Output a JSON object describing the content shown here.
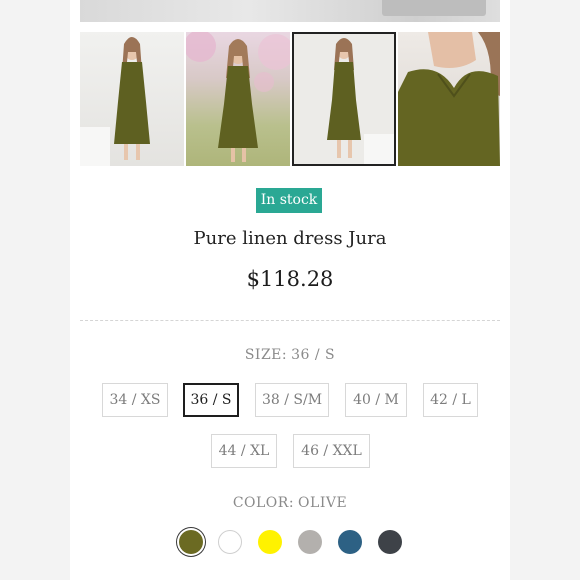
{
  "product": {
    "stock_badge": "In stock",
    "name": "Pure linen dress Jura",
    "price": "$118.28"
  },
  "gallery": {
    "thumbnails": [
      {
        "alt": "dress-front"
      },
      {
        "alt": "dress-blossom"
      },
      {
        "alt": "dress-full"
      },
      {
        "alt": "dress-closeup"
      }
    ],
    "selected_index": 2
  },
  "size": {
    "label": "SIZE:",
    "selected": "36 / S",
    "options": [
      "34 / XS",
      "36 / S",
      "38 / S/M",
      "40 / M",
      "42 / L",
      "44 / XL",
      "46 / XXL"
    ]
  },
  "color": {
    "label": "COLOR:",
    "selected": "OLIVE",
    "swatches": [
      {
        "name": "olive",
        "hex": "#6b6a22"
      },
      {
        "name": "white",
        "hex": "#ffffff"
      },
      {
        "name": "yellow",
        "hex": "#fff200"
      },
      {
        "name": "grey",
        "hex": "#b3b0ad"
      },
      {
        "name": "blue",
        "hex": "#2d6184"
      },
      {
        "name": "charcoal",
        "hex": "#3e4248"
      }
    ]
  }
}
